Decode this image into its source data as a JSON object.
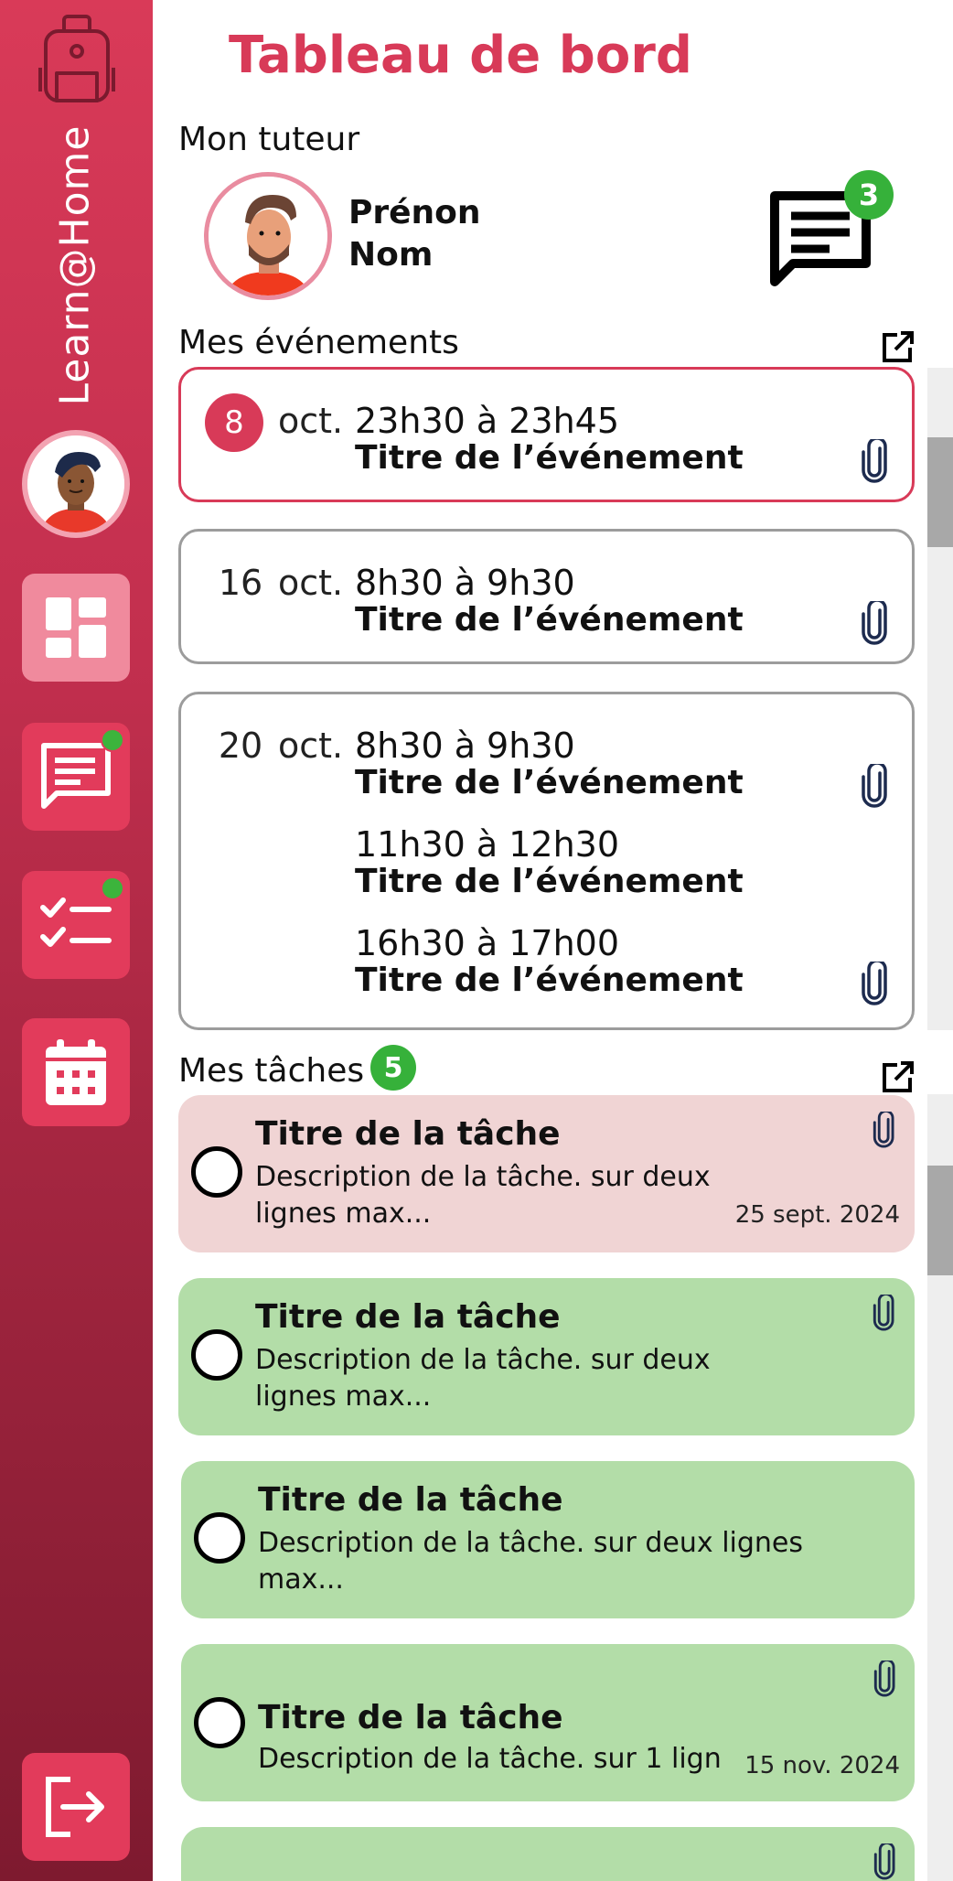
{
  "app": {
    "brand": "Learn@Home"
  },
  "page": {
    "title": "Tableau de bord"
  },
  "tutor": {
    "section_label": "Mon tuteur",
    "first_name": "Prénon",
    "last_name": "Nom",
    "unread_messages": "3"
  },
  "sidebar": {
    "items": [
      {
        "name": "dashboard",
        "icon": "dashboard-icon",
        "active": true,
        "notification": false
      },
      {
        "name": "messages",
        "icon": "message-icon",
        "active": false,
        "notification": true
      },
      {
        "name": "tasks",
        "icon": "checklist-icon",
        "active": false,
        "notification": true
      },
      {
        "name": "calendar",
        "icon": "calendar-icon",
        "active": false,
        "notification": false
      }
    ],
    "logout_icon": "logout-icon"
  },
  "events": {
    "section_label": "Mes événements",
    "items": [
      {
        "day": "8",
        "month": "oct.",
        "highlight": true,
        "entries": [
          {
            "time": "23h30 à 23h45",
            "title": "Titre de l’événement",
            "attachment": true
          }
        ]
      },
      {
        "day": "16",
        "month": "oct.",
        "highlight": false,
        "entries": [
          {
            "time": "8h30 à 9h30",
            "title": "Titre de l’événement",
            "attachment": true
          }
        ]
      },
      {
        "day": "20",
        "month": "oct.",
        "highlight": false,
        "entries": [
          {
            "time": "8h30 à 9h30",
            "title": "Titre de l’événement",
            "attachment": true
          },
          {
            "time": "11h30 à 12h30",
            "title": "Titre de l’événement",
            "attachment": false
          },
          {
            "time": "16h30 à 17h00",
            "title": "Titre de l’événement",
            "attachment": true
          }
        ]
      }
    ]
  },
  "tasks": {
    "section_label": "Mes tâches",
    "count": "5",
    "items": [
      {
        "title": "Titre de la tâche",
        "description": "Description de la tâche. sur deux lignes max...",
        "date": "25 sept. 2024",
        "status": "late",
        "attachment": true
      },
      {
        "title": "Titre de la tâche",
        "description": "Description de la tâche. sur deux lignes max...",
        "date": "",
        "status": "ok",
        "attachment": true
      },
      {
        "title": "Titre de la tâche",
        "description": "Description de la tâche. sur deux  lignes max...",
        "date": "",
        "status": "ok",
        "attachment": false
      },
      {
        "title": "Titre de la tâche",
        "description": "Description de la tâche. sur 1 lign",
        "date": "15 nov. 2024",
        "status": "ok",
        "attachment": true
      }
    ]
  },
  "colors": {
    "accent": "#d83a58",
    "success": "#36b13a",
    "task_late_bg": "#f0d4d4",
    "task_ok_bg": "#b3dda8"
  }
}
